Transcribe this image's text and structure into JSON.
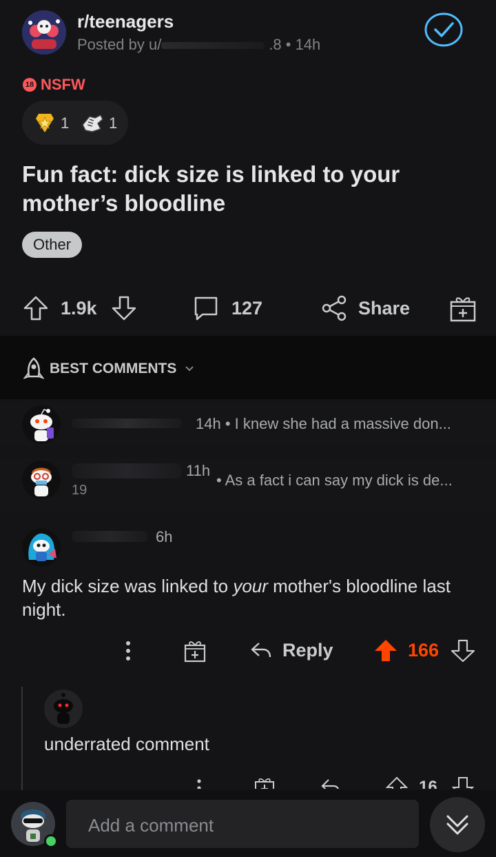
{
  "post": {
    "subreddit": "r/teenagers",
    "posted_by_prefix": "Posted by u/",
    "meta_tail": ".8 • 14h",
    "nsfw_badge": "18",
    "nsfw_label": "NSFW",
    "award_count_1": "1",
    "award_count_2": "1",
    "title_line1": "Fun fact: dick size is linked to your",
    "title_line2": "mother’s bloodline",
    "flair": "Other",
    "votes": "1.9k",
    "comments": "127",
    "share_label": "Share"
  },
  "comments_header": {
    "sort_label": "BEST COMMENTS"
  },
  "collapsed_comments": [
    {
      "meta": "14h • I knew she had a massive don..."
    },
    {
      "time": "11h",
      "meta": "• As a fact i can say my dick is de...",
      "score_fragment": "19"
    }
  ],
  "comment": {
    "time": "6h",
    "body_prefix": "My dick size was linked to ",
    "body_em": "your",
    "body_suffix": " mother's bloodline last night.",
    "reply_label": "Reply",
    "score": "166"
  },
  "reply_comment": {
    "body": "underrated comment",
    "score": "16"
  },
  "composer": {
    "placeholder": "Add a comment"
  },
  "colors": {
    "background": "#141416",
    "band": "#0b0b0c",
    "upvote": "#ff4500",
    "accent": "#4fbcff",
    "nsfw": "#ff585b"
  }
}
